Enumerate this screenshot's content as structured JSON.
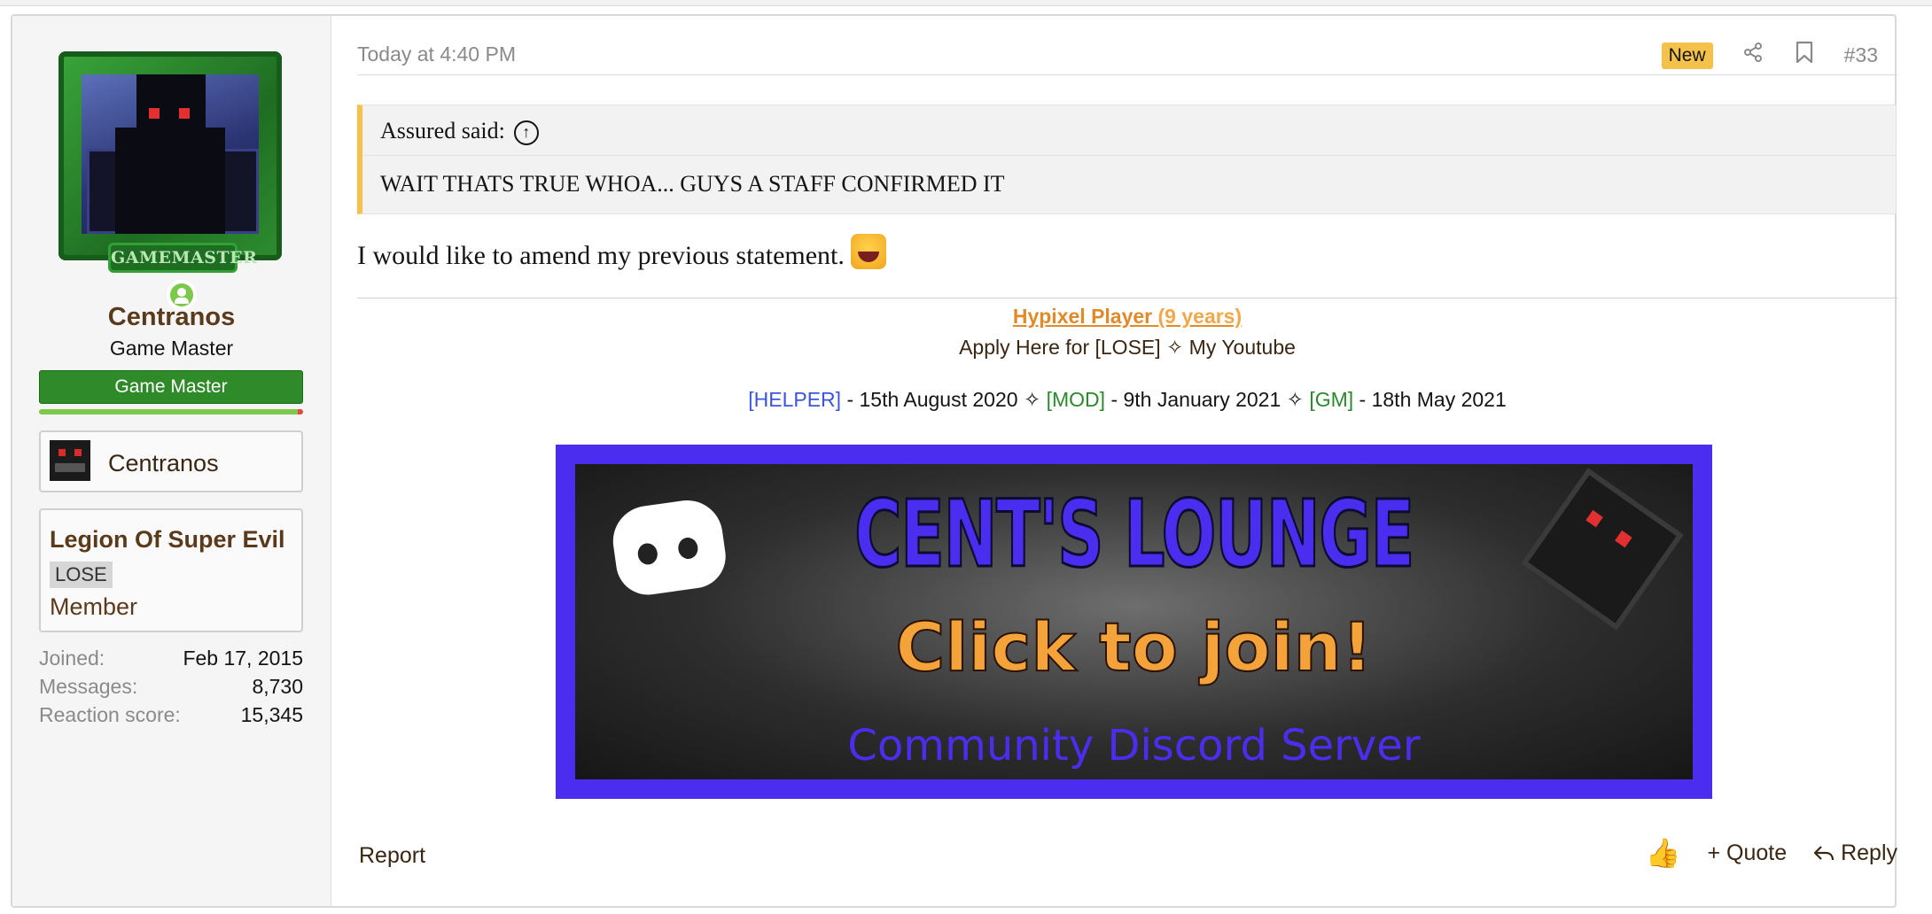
{
  "post": {
    "time": "Today at 4:40 PM",
    "new_badge": "New",
    "number": "#33",
    "share_icon": "share-icon",
    "bookmark_icon": "bookmark-icon"
  },
  "user": {
    "avatar_label": "GAMEMASTER",
    "name": "Centranos",
    "title": "Game Master",
    "banner": "Game Master",
    "mc_name": "Centranos",
    "guild_name": "Legion Of Super Evil",
    "guild_tag": "LOSE",
    "guild_rank": "Member",
    "stats": [
      {
        "label": "Joined:",
        "value": "Feb 17, 2015"
      },
      {
        "label": "Messages:",
        "value": "8,730"
      },
      {
        "label": "Reaction score:",
        "value": "15,345"
      }
    ]
  },
  "quote": {
    "author": "Assured said:",
    "text": "WAIT THATS TRUE WHOA... GUYS A STAFF CONFIRMED IT"
  },
  "message": "I would like to amend my previous statement.",
  "signature": {
    "line1": "Hypixel Player",
    "line1_years": "(9 years)",
    "line2": "Apply Here for [LOSE] ✧ My Youtube",
    "helper": "[HELPER]",
    "helper_date": " - 15th August 2020 ✧ ",
    "mod": "[MOD]",
    "mod_date": " - 9th January 2021 ✧ ",
    "gm": "[GM]",
    "gm_date": " - 18th May 2021"
  },
  "discord_banner": {
    "title": "CENT'S LOUNGE",
    "cta": "Click to join!",
    "subtitle": "Community Discord Server"
  },
  "footer": {
    "report": "Report",
    "quote": "+ Quote",
    "reply": "Reply"
  }
}
